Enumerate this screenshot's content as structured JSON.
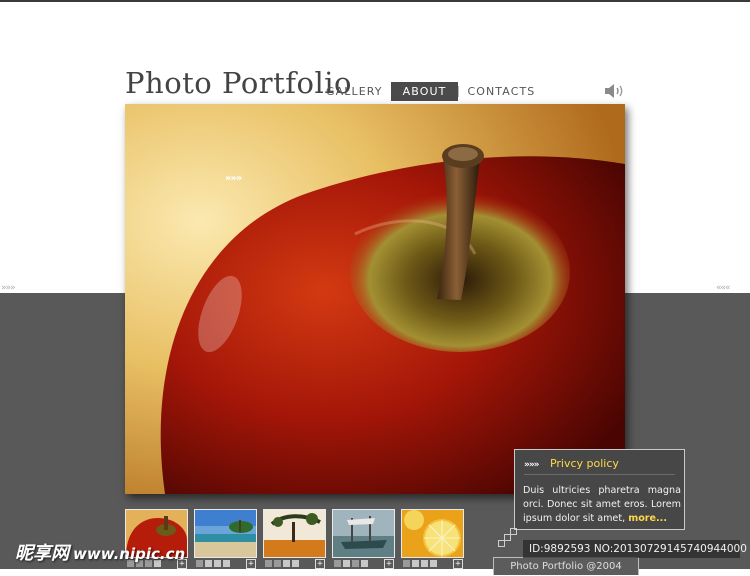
{
  "header": {
    "logo_text": "Photo Portfolio"
  },
  "nav": {
    "items": [
      {
        "label": "GALLERY",
        "active": false
      },
      {
        "label": "ABOUT",
        "active": true
      },
      {
        "label": "CONTACTS",
        "active": false
      }
    ]
  },
  "icons": {
    "sound": "speaker-icon",
    "plus": "plus-icon"
  },
  "side_nav": {
    "left": "»»»",
    "right": "«««"
  },
  "main_photo": {
    "subject": "red-apple",
    "overlay_arrows": "»»»"
  },
  "thumbnails": [
    {
      "subject": "red-apple"
    },
    {
      "subject": "tropical-beach"
    },
    {
      "subject": "savanna-tree"
    },
    {
      "subject": "boat-on-water"
    },
    {
      "subject": "lemon-slices"
    }
  ],
  "privacy_panel": {
    "arrows": "»»»",
    "title": "Privcy policy",
    "body": "Duis ultricies pharetra magna orci. Donec sit amet eros. Lorem ipsum dolor sit amet,",
    "more_link": "more..."
  },
  "footer": {
    "text": "Photo Portfolio @2004"
  },
  "watermark": {
    "site_name": "昵享网",
    "site_url": "www.nipic.cn",
    "image_id": "ID:9892593 NO:20130729145740944000"
  },
  "colors": {
    "band": "#595959",
    "nav_active_bg": "#4b4b4b",
    "accent_yellow": "#ffd94a",
    "panel_bg": "#474747"
  }
}
